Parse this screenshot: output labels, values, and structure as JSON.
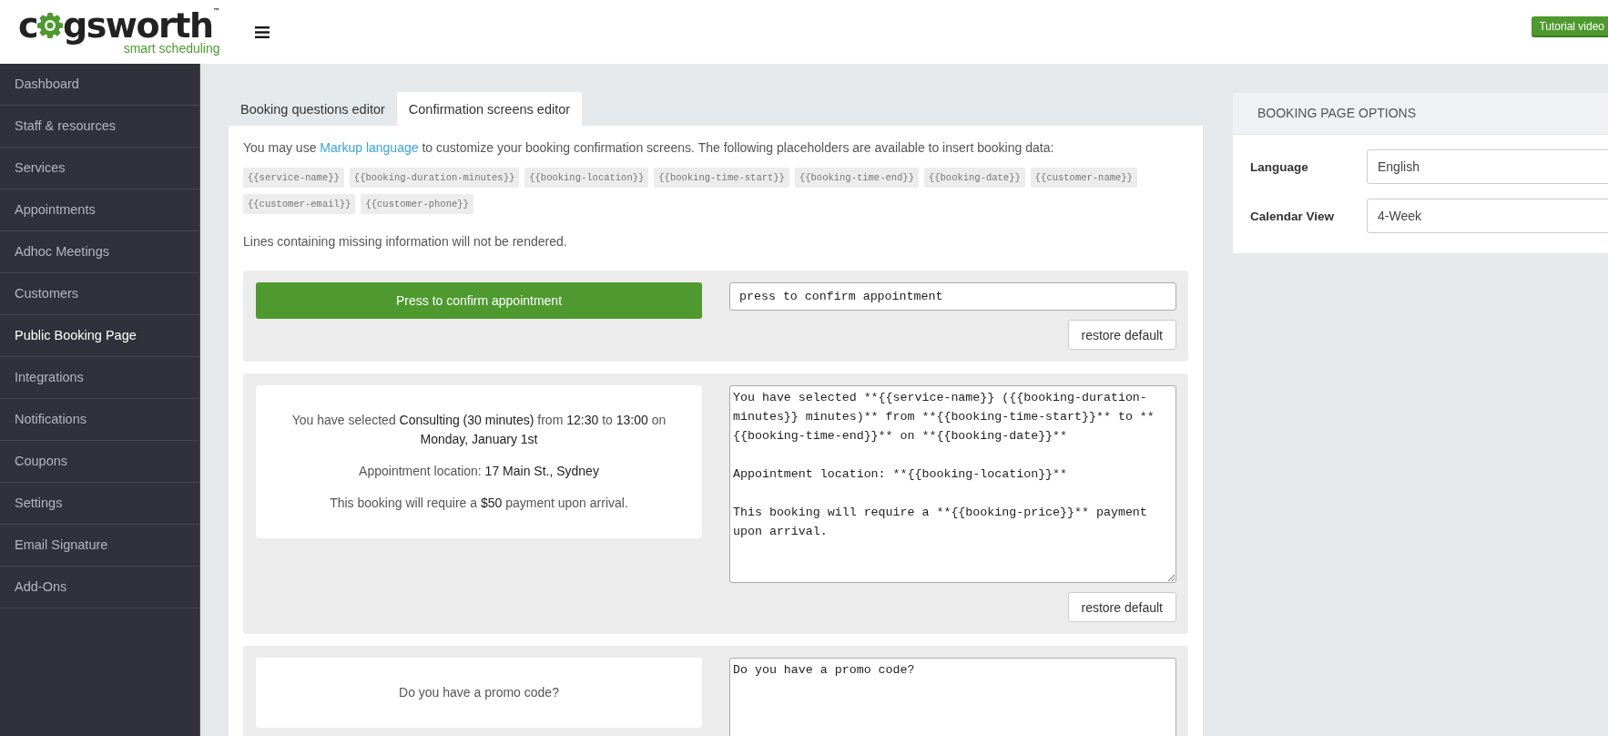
{
  "header": {
    "logo_start": "c",
    "logo_end": "gsworth",
    "logo_tm": "™",
    "logo_tagline": "smart scheduling",
    "tutorial_button": "Tutorial video"
  },
  "sidebar": {
    "items": [
      {
        "label": "Dashboard",
        "selected": false
      },
      {
        "label": "Staff & resources",
        "selected": false
      },
      {
        "label": "Services",
        "selected": false
      },
      {
        "label": "Appointments",
        "selected": false
      },
      {
        "label": "Adhoc Meetings",
        "selected": false
      },
      {
        "label": "Customers",
        "selected": false
      },
      {
        "label": "Public Booking Page",
        "selected": true
      },
      {
        "label": "Integrations",
        "selected": false
      },
      {
        "label": "Notifications",
        "selected": false
      },
      {
        "label": "Coupons",
        "selected": false
      },
      {
        "label": "Settings",
        "selected": false
      },
      {
        "label": "Email Signature",
        "selected": false
      },
      {
        "label": "Add-Ons",
        "selected": false
      }
    ]
  },
  "tabs": [
    {
      "label": "Booking questions editor",
      "selected": false
    },
    {
      "label": "Confirmation screens editor",
      "selected": true
    }
  ],
  "intro": {
    "before": "You may use ",
    "link": "Markup language",
    "after": " to customize your booking confirmation screens. The following placeholders are available to insert booking data:"
  },
  "placeholders": [
    "{{service-name}}",
    "{{booking-duration-minutes}}",
    "{{booking-location}}",
    "{{booking-time-start}}",
    "{{booking-time-end}}",
    "{{booking-date}}",
    "{{customer-name}}",
    "{{customer-email}}",
    "{{customer-phone}}"
  ],
  "note": "Lines containing missing information will not be rendered.",
  "sections": [
    {
      "kind": "button",
      "preview": [
        "Press to confirm appointment"
      ],
      "source": "press to confirm appointment",
      "restore": "restore default"
    },
    {
      "kind": "text",
      "preview": [
        "You have selected **Consulting (30 minutes)** from **12:30** to **13:00** on **Monday, January 1st**",
        "Appointment location: **17 Main St., Sydney**",
        "This booking will require a **$50** payment upon arrival."
      ],
      "source": "You have selected **{{service-name}} ({{booking-duration-minutes}} minutes)** from **{{booking-time-start}}** to **{{booking-time-end}}** on **{{booking-date}}**\n\nAppointment location: **{{booking-location}}**\n\nThis booking will require a **{{booking-price}}** payment upon arrival.",
      "restore": "restore default"
    },
    {
      "kind": "text",
      "preview": [
        "Do you have a promo code?"
      ],
      "source": "Do you have a promo code?"
    }
  ],
  "options": {
    "title": "BOOKING PAGE OPTIONS",
    "fields": [
      {
        "label": "Language",
        "value": "English"
      },
      {
        "label": "Calendar View",
        "value": "4-Week"
      }
    ]
  }
}
